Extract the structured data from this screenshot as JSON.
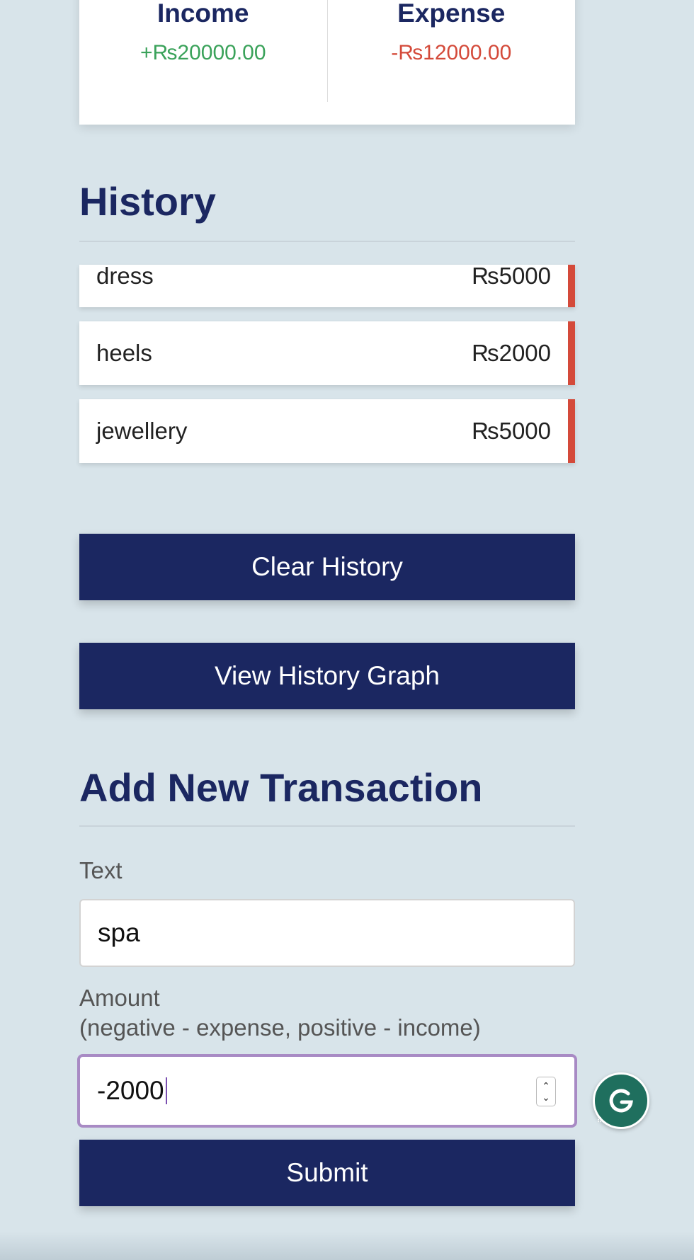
{
  "summary": {
    "income_label": "Income",
    "income_amount": "+₨20000.00",
    "expense_label": "Expense",
    "expense_amount": "-₨12000.00",
    "colors": {
      "plus": "#3aa25a",
      "minus": "#d44a3a"
    }
  },
  "history": {
    "heading": "History",
    "items": [
      {
        "text": "dress",
        "amount": "₨5000",
        "type": "expense"
      },
      {
        "text": "heels",
        "amount": "₨2000",
        "type": "expense"
      },
      {
        "text": "jewellery",
        "amount": "₨5000",
        "type": "expense"
      }
    ]
  },
  "buttons": {
    "clear_history": "Clear History",
    "view_history_graph": "View History Graph"
  },
  "form": {
    "heading": "Add New Transaction",
    "text_label": "Text",
    "text_value": "spa",
    "amount_label": "Amount",
    "amount_hint": "(negative - expense, positive - income)",
    "amount_value": "-2000",
    "submit_label": "Submit"
  },
  "widgets": {
    "grammarly_icon": "grammarly-icon"
  },
  "theme": {
    "primary": "#1b2761",
    "background": "#d8e4ea",
    "focus_border": "#a88ac4"
  }
}
